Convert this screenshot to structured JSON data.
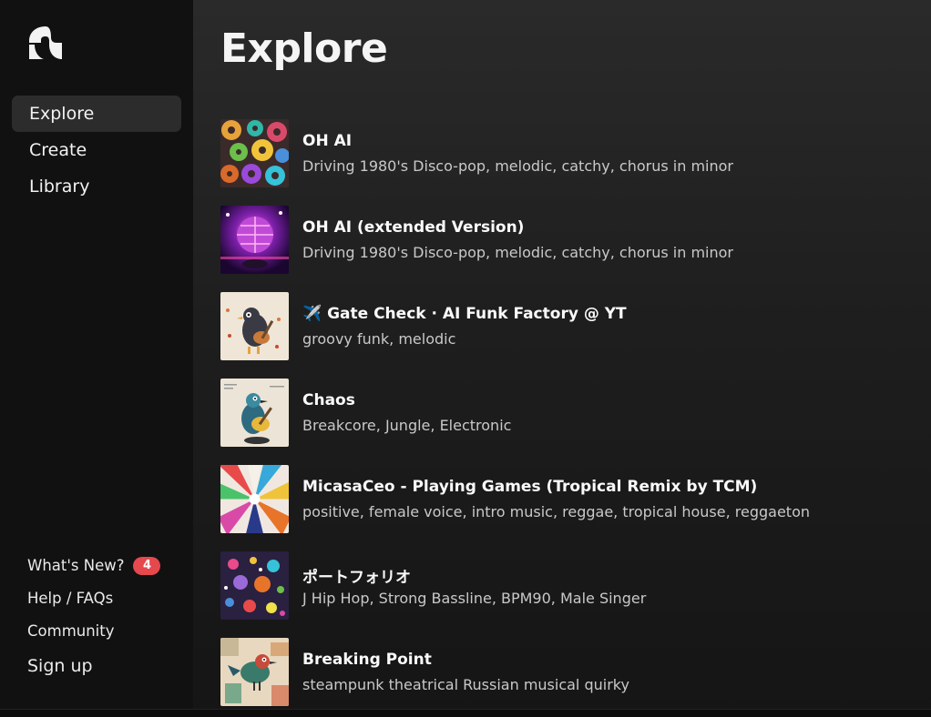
{
  "sidebar": {
    "nav": [
      {
        "label": "Explore",
        "active": true
      },
      {
        "label": "Create",
        "active": false
      },
      {
        "label": "Library",
        "active": false
      }
    ],
    "bottom": {
      "whats_new": "What's New?",
      "whats_new_badge": "4",
      "help": "Help / FAQs",
      "community": "Community",
      "signup": "Sign up"
    }
  },
  "main": {
    "title": "Explore",
    "songs": [
      {
        "title": "OH AI",
        "description": "Driving 1980's Disco-pop, melodic, catchy, chorus in minor",
        "cover_icon": "gears-art"
      },
      {
        "title": "OH AI (extended Version)",
        "description": "Driving 1980's Disco-pop, melodic, catchy, chorus in minor",
        "cover_icon": "disco-ball-art"
      },
      {
        "title": "✈️ Gate Check · AI Funk Factory @ YT",
        "description": "groovy funk, melodic",
        "cover_icon": "bird-guitar-art"
      },
      {
        "title": "Chaos",
        "description": "Breakcore, Jungle, Electronic",
        "cover_icon": "bird-guitar-yellow-art"
      },
      {
        "title": "MicasaCeo - Playing Games (Tropical Remix by TCM)",
        "description": "positive, female voice, intro music, reggae, tropical house, reggaeton",
        "cover_icon": "color-burst-art"
      },
      {
        "title": "ポートフォリオ",
        "description": "J Hip Hop, Strong Bassline, BPM90, Male Singer",
        "cover_icon": "dots-art"
      },
      {
        "title": "Breaking Point",
        "description": "steampunk theatrical Russian musical quirky",
        "cover_icon": "bird-collage-art"
      }
    ]
  },
  "colors": {
    "badge": "#e5484d",
    "active_nav_bg": "#2c2c2c",
    "sidebar_bg": "#111111"
  }
}
